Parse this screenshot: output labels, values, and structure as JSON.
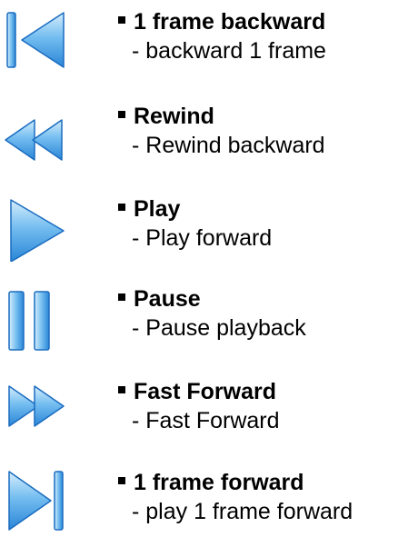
{
  "controls": [
    {
      "icon": "step-backward-icon",
      "title": "1 frame backward",
      "desc": "- backward 1 frame"
    },
    {
      "icon": "rewind-icon",
      "title": "Rewind",
      "desc": "- Rewind backward"
    },
    {
      "icon": "play-icon",
      "title": "Play",
      "desc": "- Play forward"
    },
    {
      "icon": "pause-icon",
      "title": "Pause",
      "desc": "- Pause playback"
    },
    {
      "icon": "fast-forward-icon",
      "title": "Fast Forward",
      "desc": "- Fast Forward"
    },
    {
      "icon": "step-forward-icon",
      "title": "1 frame forward",
      "desc": "- play 1 frame forward"
    }
  ],
  "colors": {
    "fill_light": "#cfe9fb",
    "fill_mid": "#64b3ec",
    "fill_dark": "#2a86d6",
    "stroke": "#1a6cc0"
  }
}
